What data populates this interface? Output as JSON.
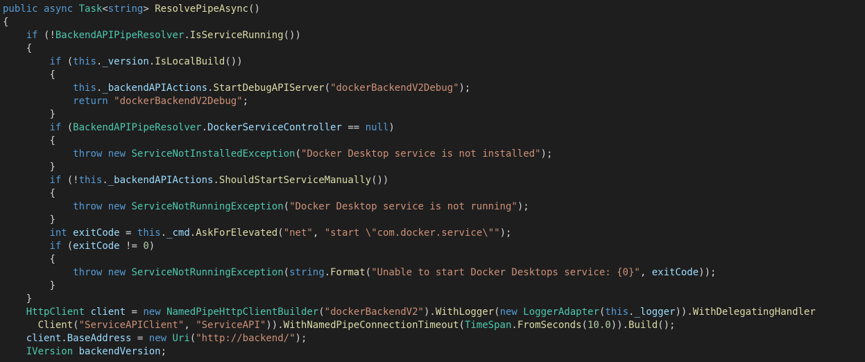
{
  "code": {
    "l1": {
      "t1": "public",
      "t2": "async",
      "t3": "Task",
      "t4": "string",
      "t5": "ResolvePipeAsync"
    },
    "l2": {
      "t1": "{"
    },
    "l3": {
      "t1": "if",
      "t2": "BackendAPIPipeResolver",
      "t3": "IsServiceRunning"
    },
    "l4": {
      "t1": "{"
    },
    "l5": {
      "t1": "if",
      "t2": "this",
      "t3": "_version",
      "t4": "IsLocalBuild"
    },
    "l6": {
      "t1": "{"
    },
    "l7": {
      "t1": "this",
      "t2": "_backendAPIActions",
      "t3": "StartDebugAPIServer",
      "t4": "\"dockerBackendV2Debug\""
    },
    "l8": {
      "t1": "return",
      "t2": "\"dockerBackendV2Debug\""
    },
    "l9": {
      "t1": "}"
    },
    "l10": {
      "t1": "if",
      "t2": "BackendAPIPipeResolver",
      "t3": "DockerServiceController",
      "t4": "null"
    },
    "l11": {
      "t1": "{"
    },
    "l12": {
      "t1": "throw",
      "t2": "new",
      "t3": "ServiceNotInstalledException",
      "t4": "\"Docker Desktop service is not installed\""
    },
    "l13": {
      "t1": "}"
    },
    "l14": {
      "t1": "if",
      "t2": "this",
      "t3": "_backendAPIActions",
      "t4": "ShouldStartServiceManually"
    },
    "l15": {
      "t1": "{"
    },
    "l16": {
      "t1": "throw",
      "t2": "new",
      "t3": "ServiceNotRunningException",
      "t4": "\"Docker Desktop service is not running\""
    },
    "l17": {
      "t1": "}"
    },
    "l18": {
      "t1": "int",
      "t2": "exitCode",
      "t3": "this",
      "t4": "_cmd",
      "t5": "AskForElevated",
      "t6": "\"net\"",
      "t7": "\"start \\\"com.docker.service\\\"\""
    },
    "l19": {
      "t1": "if",
      "t2": "exitCode",
      "t3": "0"
    },
    "l20": {
      "t1": "{"
    },
    "l21": {
      "t1": "throw",
      "t2": "new",
      "t3": "ServiceNotRunningException",
      "t4": "string",
      "t5": "Format",
      "t6": "\"Unable to start Docker Desktops service: {0}\"",
      "t7": "exitCode"
    },
    "l22": {
      "t1": "}"
    },
    "l23": {
      "t1": "}"
    },
    "l24": {
      "t1": "HttpClient",
      "t2": "client",
      "t3": "new",
      "t4": "NamedPipeHttpClientBuilder",
      "t5": "\"dockerBackendV2\"",
      "t6": "WithLogger",
      "t7": "new",
      "t8": "LoggerAdapter",
      "t9": "this",
      "t10": "_logger",
      "t11": "WithDelegatingHandler"
    },
    "l25": {
      "t1": "Client",
      "t2": "\"ServiceAPIClient\"",
      "t3": "\"ServiceAPI\"",
      "t4": "WithNamedPipeConnectionTimeout",
      "t5": "TimeSpan",
      "t6": "FromSeconds",
      "t7": "10.0",
      "t8": "Build"
    },
    "l26": {
      "t1": "client",
      "t2": "BaseAddress",
      "t3": "new",
      "t4": "Uri",
      "t5": "\"http://backend/\""
    },
    "l27": {
      "t1": "IVersion",
      "t2": "backendVersion"
    }
  }
}
